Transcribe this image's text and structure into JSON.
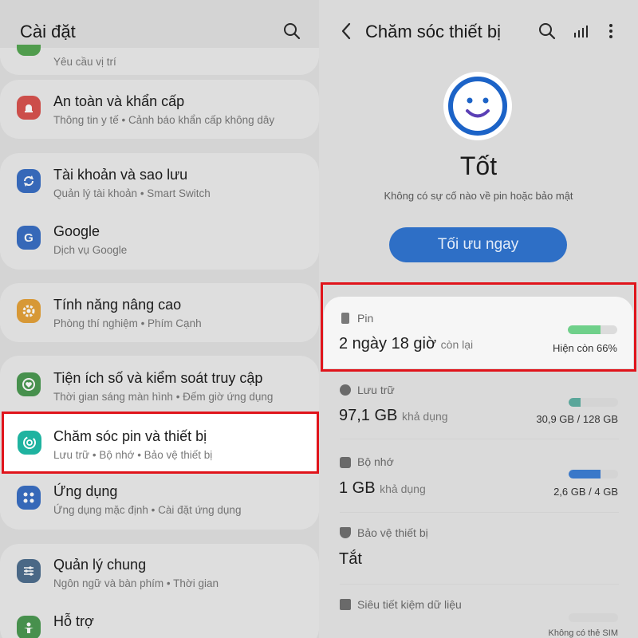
{
  "left": {
    "title": "Cài đặt",
    "items": [
      {
        "title": "",
        "sub": "Yêu cầu vị trí"
      },
      {
        "title": "An toàn và khẩn cấp",
        "sub": "Thông tin y tế  •  Cảnh báo khẩn cấp không dây"
      },
      {
        "title": "Tài khoản và sao lưu",
        "sub": "Quản lý tài khoản  •  Smart Switch"
      },
      {
        "title": "Google",
        "sub": "Dịch vụ Google"
      },
      {
        "title": "Tính năng nâng cao",
        "sub": "Phòng thí nghiệm  •  Phím Cạnh"
      },
      {
        "title": "Tiện ích số và kiểm soát truy cập",
        "sub": "Thời gian sáng màn hình  •  Đếm giờ ứng dụng"
      },
      {
        "title": "Chăm sóc pin và thiết bị",
        "sub": "Lưu trữ  •  Bộ nhớ  •  Bảo vệ thiết bị"
      },
      {
        "title": "Ứng dụng",
        "sub": "Ứng dụng mặc định  •  Cài đặt ứng dụng"
      },
      {
        "title": "Quản lý chung",
        "sub": "Ngôn ngữ và bàn phím  •  Thời gian"
      },
      {
        "title": "Hỗ trợ",
        "sub": ""
      }
    ],
    "icons": {
      "google_letter": "G"
    }
  },
  "right": {
    "title": "Chăm sóc thiết bị",
    "status": "Tốt",
    "status_sub": "Không có sự cố nào về pin hoặc bảo mật",
    "optimize_button": "Tối ưu ngay",
    "battery": {
      "label": "Pin",
      "value": "2 ngày 18 giờ",
      "unit": "còn lại",
      "level_text": "Hiện còn 66%",
      "level": 0.66
    },
    "storage": {
      "label": "Lưu trữ",
      "value": "97,1 GB",
      "unit": "khả dụng",
      "usage": "30,9 GB / 128 GB",
      "fraction": 0.24
    },
    "memory": {
      "label": "Bộ nhớ",
      "value": "1 GB",
      "unit": "khả dụng",
      "usage": "2,6 GB / 4 GB",
      "fraction": 0.65
    },
    "protection": {
      "label": "Bảo vệ thiết bị",
      "value": "Tắt"
    },
    "data_saver": {
      "label": "Siêu tiết kiệm dữ liệu",
      "partial": "Không có thẻ SIM"
    }
  },
  "colors": {
    "highlight": "#e0141b",
    "accent_blue": "#2e6fc6",
    "battery_green": "#6fd08a",
    "bar_blue": "#3a78c9",
    "storage_teal": "#5aa69a"
  }
}
